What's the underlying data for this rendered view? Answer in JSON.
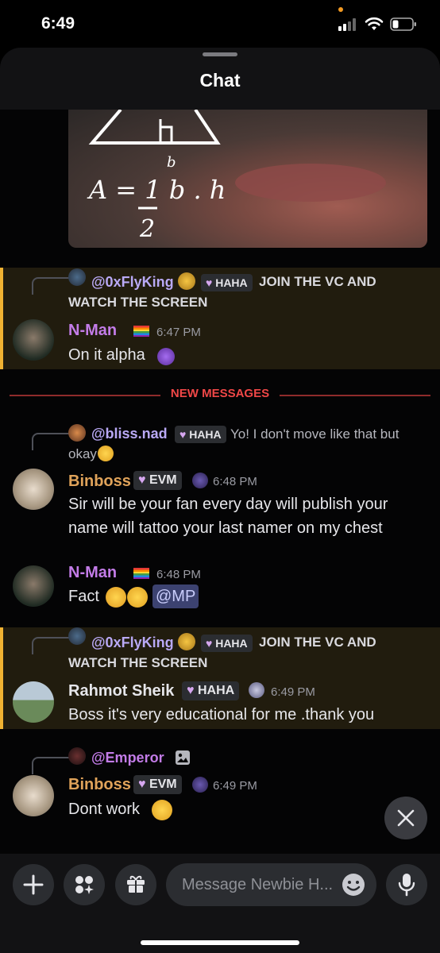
{
  "status_bar": {
    "time": "6:49"
  },
  "header": {
    "title": "Chat"
  },
  "divider": {
    "label": "NEW MESSAGES"
  },
  "messages": [
    {
      "reply": {
        "name": "@0xFlyKing",
        "name_color": "#b9a9f5",
        "tag": "HAHA",
        "text_line1": "JOIN THE VC AND",
        "text_line2": "WATCH THE SCREEN"
      },
      "author": "N-Man",
      "author_color": "#c37ce8",
      "time": "6:47 PM",
      "text": "On it alpha"
    },
    {
      "reply": {
        "name": "@bliss.nad",
        "name_color": "#b9a9f5",
        "tag": "HAHA",
        "text_line1": "Yo! I don't move like that but",
        "text_line2": "okay"
      },
      "author": "Binboss",
      "author_color": "#e0a35a",
      "tag": "EVM",
      "time": "6:48 PM",
      "text_line1": "Sir will be your fan every day will publish your",
      "text_line2": "name will tattoo your last namer on my chest"
    },
    {
      "author": "N-Man",
      "author_color": "#c37ce8",
      "time": "6:48 PM",
      "text": "Fact",
      "mention": "@MP"
    },
    {
      "reply": {
        "name": "@0xFlyKing",
        "name_color": "#b9a9f5",
        "tag": "HAHA",
        "text_line1": "JOIN THE VC AND",
        "text_line2": "WATCH THE SCREEN"
      },
      "author": "Rahmot Sheik",
      "author_color": "#e6e6ea",
      "tag": "HAHA",
      "time": "6:49 PM",
      "text": "Boss it's very educational for me .thank you"
    },
    {
      "reply": {
        "name": "@Emperor",
        "name_color": "#c37ce8"
      },
      "author": "Binboss",
      "author_color": "#e0a35a",
      "tag": "EVM",
      "time": "6:49 PM",
      "text": "Dont work"
    }
  ],
  "composer": {
    "placeholder": "Message Newbie H..."
  },
  "colors": {
    "highlight_bg": "#211c0e",
    "highlight_bar": "#f0b232",
    "new_messages": "#f04747",
    "mention_bg": "#3c4270"
  },
  "icons": {
    "plus": "plus-icon",
    "apps": "apps-icon",
    "gift": "gift-icon",
    "emoji": "emoji-icon",
    "mic": "microphone-icon",
    "close": "close-icon",
    "image": "image-icon"
  }
}
